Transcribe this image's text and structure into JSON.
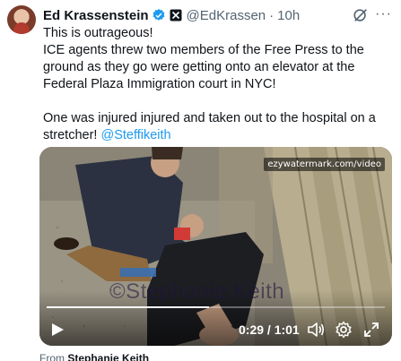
{
  "tweet": {
    "author_name": "Ed Krassenstein",
    "handle": "@EdKrassen",
    "separator": "·",
    "time": "10h",
    "more_label": "···",
    "text_line1": "This is outrageous!\nICE agents threw two members of the Free Press to the ground as they go were getting onto an elevator at the Federal Plaza Immigration court in NYC!\n\nOne was injured injured and taken out to the hospital on a stretcher! ",
    "mention": "@Steffikeith"
  },
  "media": {
    "watermark_top": "ezywatermark.com/video",
    "watermark_photo": "©Stephanie Keith",
    "timecode": "0:29 / 1:01",
    "progress": 0.48
  },
  "footer": {
    "from_label": "From",
    "from_name": "Stephanie Keith"
  },
  "icons": {
    "verified": "verified-badge-icon",
    "affiliation": "affiliation-icon",
    "grok": "grok-icon",
    "more": "more-icon",
    "play": "play-icon",
    "volume": "volume-icon",
    "settings": "settings-gear-icon",
    "fullscreen": "fullscreen-icon"
  },
  "colors": {
    "link": "#1d9bf0",
    "secondary_text": "#536471",
    "primary_text": "#0f1419"
  }
}
